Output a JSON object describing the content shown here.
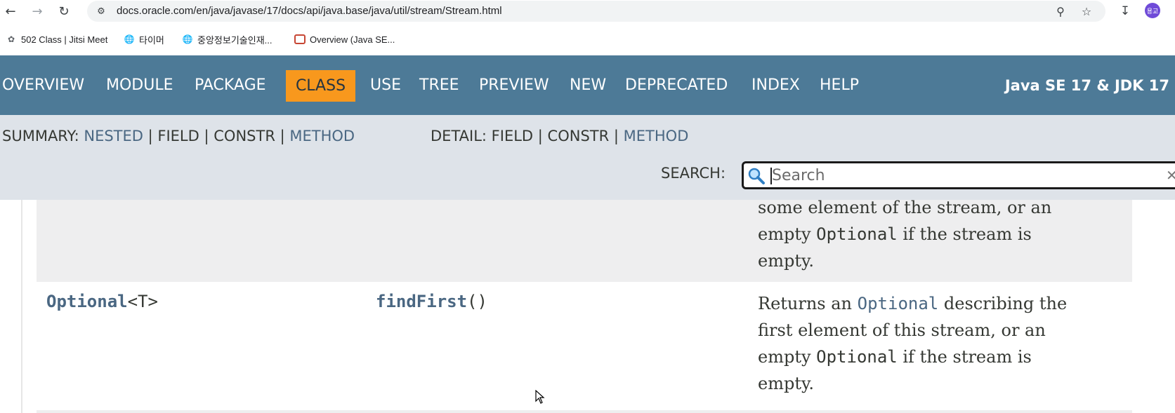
{
  "browser": {
    "url": "docs.oracle.com/en/java/javase/17/docs/api/java.base/java/util/stream/Stream.html",
    "avatar_text": "용교",
    "bookmarks": [
      {
        "label": "502 Class | Jitsi Meet",
        "icon": "jitsi-icon"
      },
      {
        "label": "타이머",
        "icon": "globe-icon"
      },
      {
        "label": "중앙정보기술인재...",
        "icon": "globe-icon"
      },
      {
        "label": "Overview (Java SE...",
        "icon": "oracle-icon"
      }
    ]
  },
  "topnav": {
    "items": [
      "OVERVIEW",
      "MODULE",
      "PACKAGE",
      "CLASS",
      "USE",
      "TREE",
      "PREVIEW",
      "NEW",
      "DEPRECATED",
      "INDEX",
      "HELP"
    ],
    "active": "CLASS",
    "about": "Java SE 17 & JDK 17"
  },
  "subnav": {
    "summary_label": "SUMMARY:",
    "summary_items": [
      "NESTED",
      "FIELD",
      "CONSTR",
      "METHOD"
    ],
    "detail_label": "DETAIL:",
    "detail_items": [
      "FIELD",
      "CONSTR",
      "METHOD"
    ],
    "sep": "|",
    "search_label": "SEARCH:",
    "search_placeholder": "Search"
  },
  "rows": {
    "prev": {
      "desc_line1": "some element of the stream, or an",
      "desc_line2_a": "empty ",
      "desc_line2_code": "Optional",
      "desc_line2_b": " if the stream is",
      "desc_line3": "empty."
    },
    "find": {
      "type_link": "Optional",
      "type_generic": "<T>",
      "method_link": "findFirst",
      "method_parens": "()",
      "desc_a": "Returns an ",
      "desc_code": "Optional",
      "desc_b": " describing the",
      "desc_line2": "first element of this stream, or an",
      "desc_line3_a": "empty ",
      "desc_line3_code": "Optional",
      "desc_line3_b": " if the stream is",
      "desc_line4": "empty."
    }
  },
  "colors": {
    "nav_bg": "#4d7a97",
    "nav_active": "#f8981d",
    "subnav_bg": "#dee3e9",
    "link": "#4a6782"
  }
}
